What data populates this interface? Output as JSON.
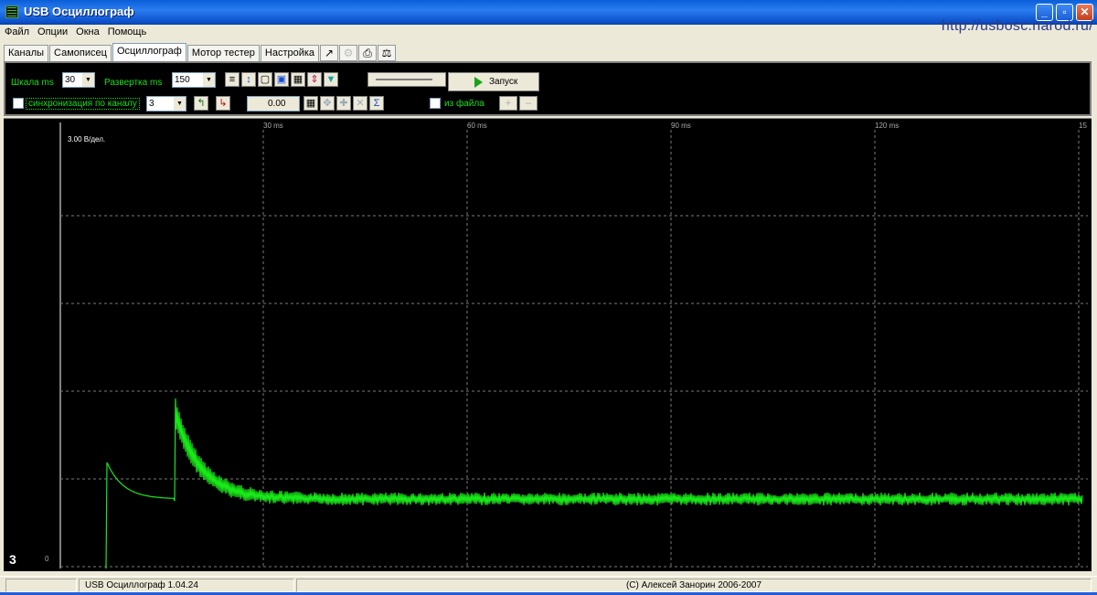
{
  "window": {
    "title": "USB Осциллограф",
    "url_watermark": "http://usbosc.narod.ru/",
    "controls": {
      "minimize": "_",
      "maximize": "▫",
      "close": "✕"
    }
  },
  "menu": [
    "Файл",
    "Опции",
    "Окна",
    "Помощь"
  ],
  "tabs": [
    "Каналы",
    "Самописец",
    "Осциллограф",
    "Мотор тестер",
    "Настройка"
  ],
  "active_tab": "Осциллограф",
  "toolbar": {
    "scale_label": "Шкала ms",
    "scale_value": "30",
    "sweep_label": "Развертка ms",
    "sweep_value": "150",
    "sync_label": "синхронизация по каналу",
    "sync_channel": "3",
    "offset_value": "0.00",
    "from_file_label": "из файла",
    "start_label": "Запуск",
    "plus_label": "+",
    "minus_label": "–"
  },
  "scope": {
    "volts_per_div": "3.00 В/дел.",
    "channel_number": "3",
    "zero_label": "0",
    "time_labels": [
      "30 ms",
      "60 ms",
      "90 ms",
      "120 ms",
      "15"
    ],
    "trace_color": "#19e819",
    "grid_color": "#7a7a7a"
  },
  "status": {
    "version": "USB Осциллограф 1.04.24",
    "copyright": "(C) Алексей Занорин 2006-2007"
  }
}
